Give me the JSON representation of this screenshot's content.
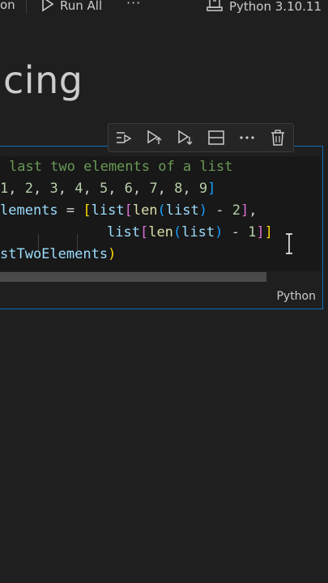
{
  "toolbar": {
    "fragment": "on",
    "run_all_label": "Run All",
    "more": "···",
    "kernel_label": "Python 3.10.11"
  },
  "heading": {
    "text": "cing"
  },
  "cell": {
    "language": "Python",
    "toolbar_icons": [
      "run-by-line-icon",
      "execute-above-icon",
      "execute-below-icon",
      "split-cell-icon",
      "more-icon",
      "delete-icon"
    ],
    "code": {
      "line1": {
        "comment": "last two elements of a list"
      },
      "line2": {
        "t1": "1",
        "t2": ", ",
        "t3": "2",
        "t4": ", ",
        "t5": "3",
        "t6": ", ",
        "t7": "4",
        "t8": ", ",
        "t9": "5",
        "t10": ", ",
        "t11": "6",
        "t12": ", ",
        "t13": "7",
        "t14": ", ",
        "t15": "8",
        "t16": ", ",
        "t17": "9",
        "t18": "]"
      },
      "line3": {
        "var": "lements",
        "eq": " = ",
        "b1": "[",
        "list": "list",
        "b2": "[",
        "len": "len",
        "b3": "(",
        "list2": "list",
        "b3c": ")",
        "minus": " - ",
        "num": "2",
        "b2c": "]",
        "comma": ","
      },
      "line4": {
        "list": "list",
        "b2": "[",
        "len": "len",
        "b3": "(",
        "list2": "list",
        "b3c": ")",
        "minus": " - ",
        "num": "1",
        "b2c": "]",
        "b1c": "]"
      },
      "line5": {
        "var": "stTwoElements",
        "paren": ")"
      }
    }
  },
  "colors": {
    "accent": "#0e6ebd",
    "comment": "#6a9955",
    "number": "#b5cea8",
    "function": "#dcdcaa",
    "variable": "#9cdcfe"
  }
}
